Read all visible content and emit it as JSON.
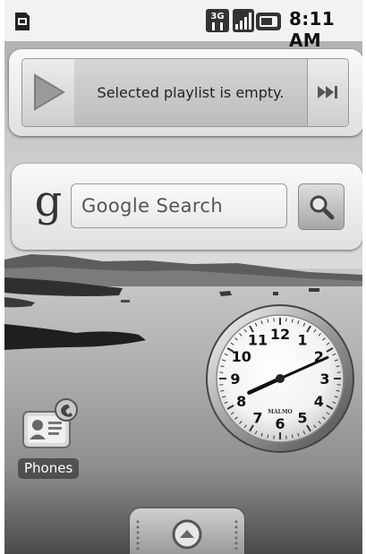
{
  "status_bar": {
    "time": "8:11 AM",
    "network_badge": "3G",
    "icons": [
      "sd-card-icon",
      "3g-icon",
      "signal-icon",
      "battery-icon"
    ]
  },
  "music_widget": {
    "message": "Selected playlist is empty.",
    "play_icon": "play-icon",
    "next_icon": "next-track-icon"
  },
  "search_widget": {
    "logo_letter": "g",
    "placeholder": "Google Search",
    "button_icon": "magnifier-icon"
  },
  "clock_widget": {
    "brand": "MALMO",
    "numerals": [
      "12",
      "1",
      "2",
      "3",
      "4",
      "5",
      "6",
      "7",
      "8",
      "9",
      "10",
      "11"
    ],
    "time_shown": "8:11"
  },
  "desktop": {
    "shortcuts": [
      {
        "label": "Phones",
        "icon": "contact-card-icon"
      }
    ]
  },
  "launcher": {
    "icon": "app-drawer-up-icon"
  }
}
